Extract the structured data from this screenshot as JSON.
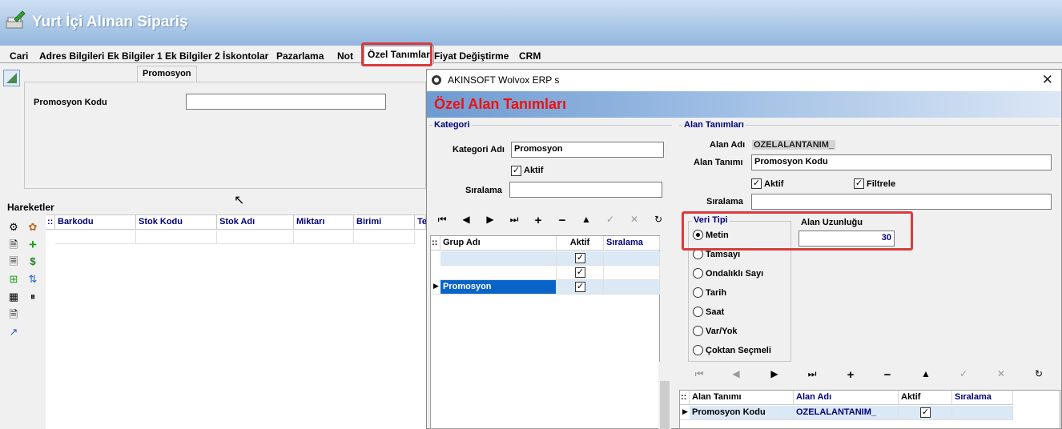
{
  "main": {
    "title": "Yurt İçi Alınan Sipariş"
  },
  "tabs": [
    "Cari",
    "Adres Bilgileri",
    "Ek Bilgiler 1",
    "Ek Bilgiler 2",
    "İskontolar",
    "Pazarlama",
    "Not",
    "Özel Tanımlar",
    "Fiyat Değiştirme",
    "CRM"
  ],
  "left_panel": {
    "subtab": "Promosyon",
    "field_label": "Promosyon Kodu",
    "field_value": ""
  },
  "hareketler": {
    "label": "Hareketler",
    "columns": [
      "Barkodu",
      "Stok Kodu",
      "Stok Adı",
      "Miktarı",
      "Birimi",
      "Te"
    ]
  },
  "dialog": {
    "window_title": "AKINSOFT Wolvox ERP s",
    "header": "Özel Alan Tanımları",
    "kategori": {
      "group_title": "Kategori",
      "adi_label": "Kategori Adı",
      "adi_value": "Promosyon",
      "aktif_label": "Aktif",
      "siralama_label": "Sıralama",
      "siralama_value": "",
      "grid_columns": [
        "Grup Adı",
        "Aktif",
        "Sıralama"
      ],
      "rows": [
        {
          "grup": "",
          "aktif": true
        },
        {
          "grup": "",
          "aktif": true
        },
        {
          "grup": "Promosyon",
          "aktif": true
        }
      ]
    },
    "alan": {
      "group_title": "Alan Tanımları",
      "adi_label": "Alan Adı",
      "adi_value": "OZELALANTANIM_",
      "tanim_label": "Alan Tanımı",
      "tanim_value": "Promosyon Kodu",
      "aktif_label": "Aktif",
      "filtrele_label": "Filtrele",
      "siralama_label": "Sıralama",
      "siralama_value": "",
      "veri_tipi_title": "Veri Tipi",
      "veri_tipleri": [
        "Metin",
        "Tamsayı",
        "Ondalıklı Sayı",
        "Tarih",
        "Saat",
        "Var/Yok",
        "Çoktan Seçmeli"
      ],
      "selected_tip": "Metin",
      "uzunluk_label": "Alan Uzunluğu",
      "uzunluk_value": "30",
      "grid_columns": [
        "Alan Tanımı",
        "Alan Adı",
        "Aktif",
        "Sıralama"
      ],
      "grid_row": {
        "tanim": "Promosyon Kodu",
        "adi": "OZELALANTANIM_",
        "aktif": true
      }
    },
    "nav_icons": [
      "first-icon",
      "prev-icon",
      "next-icon",
      "last-icon",
      "add-icon",
      "delete-icon",
      "edit-icon",
      "post-icon",
      "cancel-icon",
      "refresh-icon"
    ]
  },
  "colors": {
    "header_red": "#ee1111",
    "grid_header_blue": "#00007f",
    "highlight_red": "#d83c3c",
    "selected_row": "#0a64c8"
  }
}
